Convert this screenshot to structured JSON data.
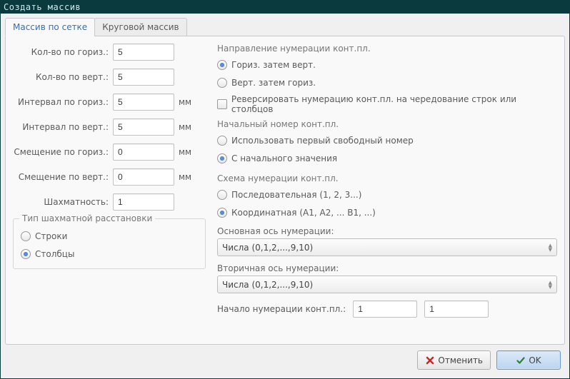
{
  "window": {
    "title": "Создать массив"
  },
  "tabs": {
    "grid": "Массив по сетке",
    "circ": "Круговой массив"
  },
  "left": {
    "count_h_label": "Кол-во по гориз.:",
    "count_h": "5",
    "count_v_label": "Кол-во по верт.:",
    "count_v": "5",
    "int_h_label": "Интервал по гориз.:",
    "int_h": "5",
    "int_v_label": "Интервал по верт.:",
    "int_v": "5",
    "off_h_label": "Смещение по гориз.:",
    "off_h": "0",
    "off_v_label": "Смещение по верт.:",
    "off_v": "0",
    "stagger_label": "Шахматность:",
    "stagger": "1",
    "unit": "мм",
    "stagger_group_title": "Тип шахматной расстановки",
    "rows": "Строки",
    "cols": "Столбцы"
  },
  "right": {
    "direction_title": "Направление нумерации конт.пл.",
    "dir_hv": "Гориз. затем верт.",
    "dir_vh": "Верт. затем гориз.",
    "reverse": "Реверсировать нумерацию конт.пл. на чередование строк или столбцов",
    "start_title": "Начальный номер конт.пл.",
    "start_free": "Использовать первый свободный номер",
    "start_val": "С начального значения",
    "scheme_title": "Схема нумерации конт.пл.",
    "scheme_seq": "Последовательная (1, 2, 3...)",
    "scheme_coord": "Координатная (A1, A2, ... B1, ...)",
    "primary_label": "Основная ось нумерации:",
    "primary_value": "Числа (0,1,2,...,9,10)",
    "secondary_label": "Вторичная ось нумерации:",
    "secondary_value": "Числа (0,1,2,...,9,10)",
    "start_inline_label": "Начало нумерации конт.пл.:",
    "start_a": "1",
    "start_b": "1"
  },
  "footer": {
    "cancel": "Отменить",
    "ok": "OK"
  }
}
